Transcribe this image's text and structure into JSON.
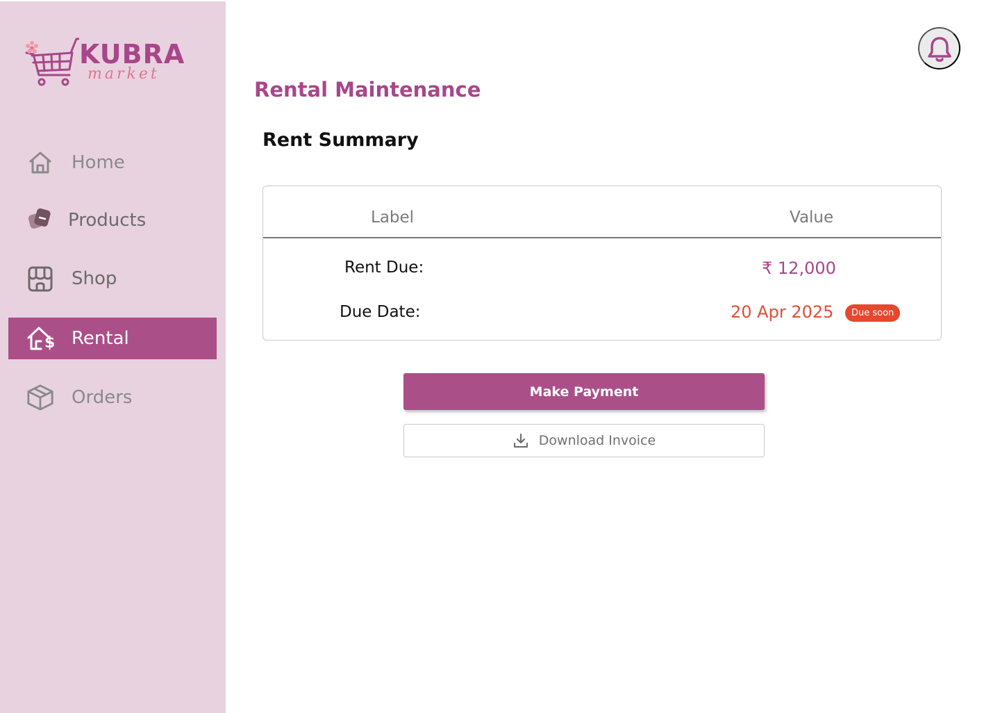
{
  "brand": {
    "name": "KUBRA",
    "tagline": "market",
    "logo_icon": "shopping-cart-flower-icon"
  },
  "sidebar": {
    "items": [
      {
        "label": "Home",
        "icon": "home-icon",
        "active": false
      },
      {
        "label": "Products",
        "icon": "products-icon",
        "active": false
      },
      {
        "label": "Shop",
        "icon": "shop-icon",
        "active": false
      },
      {
        "label": "Rental",
        "icon": "rental-house-dollar-icon",
        "active": true
      },
      {
        "label": "Orders",
        "icon": "orders-box-icon",
        "active": false
      }
    ]
  },
  "header": {
    "notification_icon": "bell-icon"
  },
  "main": {
    "title": "Rental Maintenance",
    "section_title": "Rent Summary",
    "table": {
      "columns": [
        "Label",
        "Value"
      ],
      "rows": [
        {
          "label": "Rent Due:",
          "value": "₹ 12,000"
        },
        {
          "label": "Due Date:",
          "value": "20 Apr 2025",
          "badge": "Due soon"
        }
      ]
    },
    "actions": {
      "primary": "Make Payment",
      "secondary": "Download Invoice",
      "secondary_icon": "download-icon"
    }
  },
  "colors": {
    "brand": "#ab4f89",
    "sidebar_bg": "#e9d2df",
    "warning": "#e6472e"
  }
}
